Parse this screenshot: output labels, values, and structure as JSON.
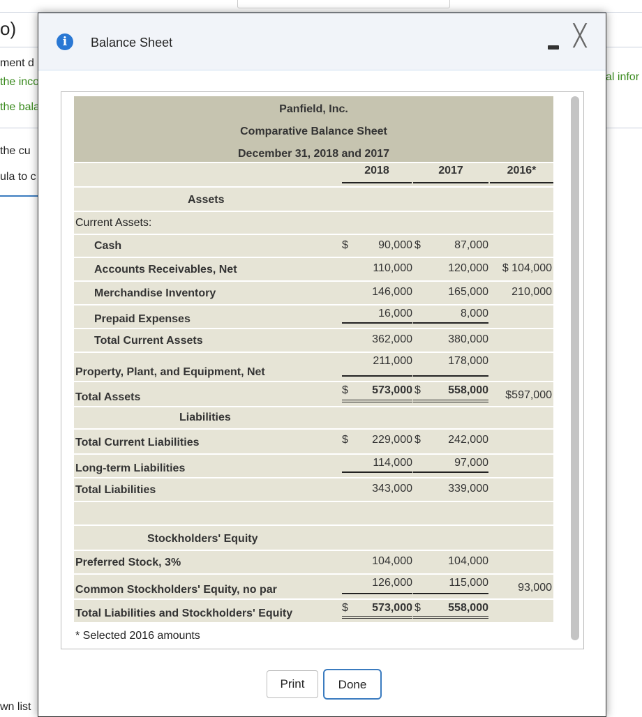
{
  "background": {
    "left_fragments": [
      "o)",
      "ment d",
      "the inco",
      "the bala",
      "the cu",
      "ula to c",
      "wn list"
    ],
    "right_fragment": "al infor"
  },
  "dialog": {
    "title": "Balance Sheet",
    "icon": "info-icon",
    "print_label": "Print",
    "done_label": "Done"
  },
  "sheet": {
    "company": "Panfield, Inc.",
    "statement": "Comparative Balance Sheet",
    "date": "December 31, 2018 and 2017",
    "years": [
      "2018",
      "2017",
      "2016*"
    ],
    "rows": [
      {
        "label": "Assets",
        "kind": "section"
      },
      {
        "label": "Current Assets:",
        "kind": "plain"
      },
      {
        "label": "Cash",
        "indent": true,
        "v": [
          "$",
          "90,000",
          "$",
          "87,000",
          ""
        ]
      },
      {
        "label": "Accounts Receivables, Net",
        "indent": true,
        "v": [
          "",
          "110,000",
          "",
          "120,000",
          "$ 104,000"
        ]
      },
      {
        "label": "Merchandise Inventory",
        "indent": true,
        "v": [
          "",
          "146,000",
          "",
          "165,000",
          "210,000"
        ]
      },
      {
        "label": "Prepaid Expenses",
        "indent": true,
        "v": [
          "",
          "16,000",
          "",
          "8,000",
          ""
        ],
        "line": "single"
      },
      {
        "label": "Total Current Assets",
        "indent": true,
        "v": [
          "",
          "362,000",
          "",
          "380,000",
          ""
        ]
      },
      {
        "label": "Property, Plant, and Equipment, Net",
        "v": [
          "",
          "211,000",
          "",
          "178,000",
          ""
        ],
        "line": "single"
      },
      {
        "label": "Total Assets",
        "v": [
          "$",
          "573,000",
          "$",
          "558,000",
          "$597,000"
        ],
        "line": "double",
        "boldnum": true
      },
      {
        "label": "Liabilities",
        "kind": "section"
      },
      {
        "label": "Total Current Liabilities",
        "v": [
          "$",
          "229,000",
          "$",
          "242,000",
          ""
        ]
      },
      {
        "label": "Long-term Liabilities",
        "v": [
          "",
          "114,000",
          "",
          "97,000",
          ""
        ],
        "line": "single"
      },
      {
        "label": "Total Liabilities",
        "v": [
          "",
          "343,000",
          "",
          "339,000",
          ""
        ]
      },
      {
        "label": "",
        "kind": "blank"
      },
      {
        "label": "Stockholders' Equity",
        "kind": "section"
      },
      {
        "label": "Preferred Stock, 3%",
        "v": [
          "",
          "104,000",
          "",
          "104,000",
          ""
        ]
      },
      {
        "label": "Common Stockholders' Equity, no par",
        "v": [
          "",
          "126,000",
          "",
          "115,000",
          "93,000"
        ],
        "line": "single"
      },
      {
        "label": "Total Liabilities and Stockholders' Equity",
        "v": [
          "$",
          "573,000",
          "$",
          "558,000",
          ""
        ],
        "line": "double",
        "boldnum": true
      }
    ],
    "footnote": "* Selected 2016 amounts"
  }
}
